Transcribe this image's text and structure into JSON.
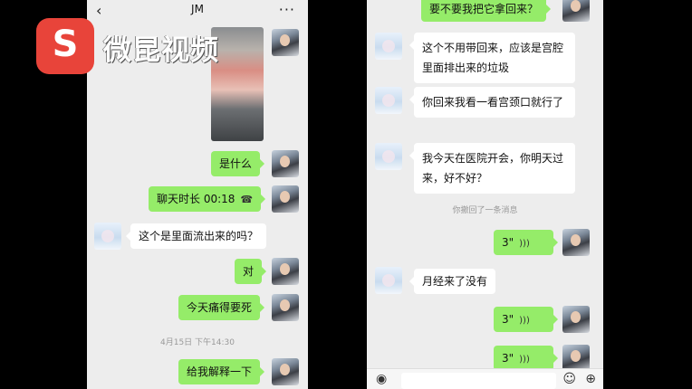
{
  "watermark": {
    "logo_glyph": "S",
    "text": "微昆视频"
  },
  "left_chat": {
    "header": {
      "back_icon": "‹",
      "title": "JM",
      "more_icon": "···"
    },
    "messages": {
      "m1": "是什么",
      "m2": "聊天时长 00:18",
      "m2_icon": "☎",
      "m3": "这个是里面流出来的吗？",
      "m4": "对",
      "m5": "今天痛得要死",
      "ts": "4月15日 下午14:30",
      "m6": "给我解释一下"
    }
  },
  "right_chat": {
    "messages": {
      "r1": "要不要我把它拿回来？",
      "r2": "这个不用带回来，应该是宫腔里面排出来的垃圾",
      "r3": "你回来我看一看宫颈口就行了",
      "r4": "我今天在医院开会，你明天过来，好不好？",
      "recall": "你撤回了一条消息",
      "v1": "3\"",
      "r5": "月经来了没有",
      "v2": "3\"",
      "v3": "3\""
    },
    "bottom": {
      "voice_icon": "◉",
      "emoji_icon": "☺",
      "plus_icon": "⊕"
    }
  }
}
